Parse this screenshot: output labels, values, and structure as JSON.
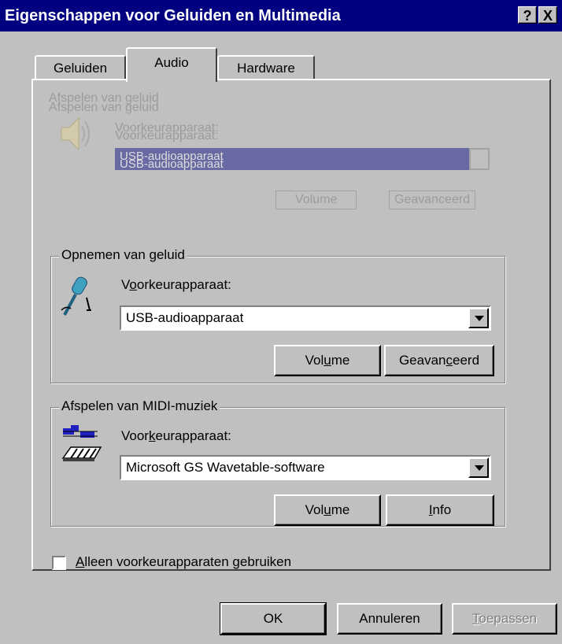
{
  "window": {
    "title": "Eigenschappen voor Geluiden en Multimedia",
    "help_glyph": "?",
    "close_glyph": "X"
  },
  "tabs": [
    {
      "label": "Geluiden",
      "active": false
    },
    {
      "label": "Audio",
      "active": true
    },
    {
      "label": "Hardware",
      "active": false
    }
  ],
  "playback": {
    "legend": "Afspelen van geluid",
    "device_label": "Voorkeurapparaat:",
    "device_value": "USB-audioapparaat",
    "volume_label": "Volume",
    "advanced_label": "Geavanceerd"
  },
  "recording": {
    "legend": "Opnemen van geluid",
    "device_label_pre": "V",
    "device_label_u": "o",
    "device_label_post": "orkeurapparaat:",
    "device_value": "USB-audioapparaat",
    "volume_pre": "Vol",
    "volume_u": "u",
    "volume_post": "me",
    "advanced_pre": "Geavan",
    "advanced_u": "c",
    "advanced_post": "eerd"
  },
  "midi": {
    "legend": "Afspelen van MIDI-muziek",
    "device_label_pre": "Voor",
    "device_label_u": "k",
    "device_label_post": "eurapparaat:",
    "device_value": "Microsoft GS Wavetable-software",
    "volume_pre": "Vol",
    "volume_u": "u",
    "volume_post": "me",
    "info_u": "I",
    "info_post": "nfo"
  },
  "only_preferred": {
    "u": "A",
    "post": "lleen voorkeurapparaten gebruiken",
    "checked": false
  },
  "buttons": {
    "ok": "OK",
    "cancel": "Annuleren",
    "apply_u": "T",
    "apply_post": "oepassen"
  }
}
